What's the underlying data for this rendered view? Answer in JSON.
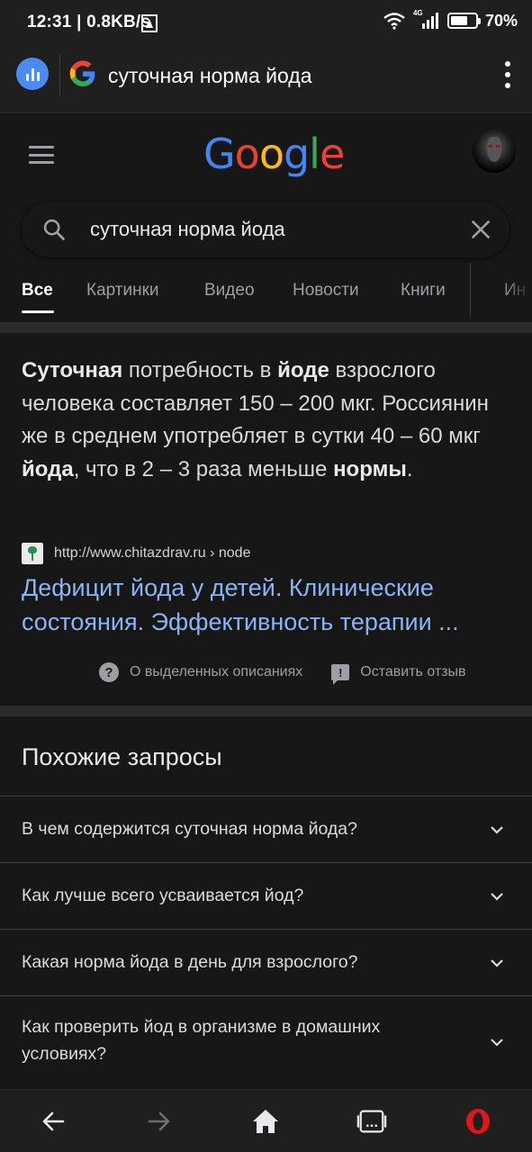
{
  "status_bar": {
    "time_speed": "12:31 | 0.8KB/s",
    "network": "4G",
    "battery_text": "70%",
    "battery_level": 0.7
  },
  "browser": {
    "url_title": "суточная норма йода"
  },
  "google": {
    "logo_letters": [
      "G",
      "o",
      "o",
      "g",
      "l",
      "e"
    ],
    "logo_colors": [
      "#4285f4",
      "#ea4335",
      "#fbbc05",
      "#4285f4",
      "#34a853",
      "#ea4335"
    ]
  },
  "search": {
    "query": "суточная норма йода"
  },
  "tabs": [
    {
      "label": "Все",
      "active": true
    },
    {
      "label": "Картинки",
      "active": false
    },
    {
      "label": "Видео",
      "active": false
    },
    {
      "label": "Новости",
      "active": false
    },
    {
      "label": "Книги",
      "active": false
    },
    {
      "label": "Ин",
      "active": false
    }
  ],
  "snippet": {
    "text_parts": [
      {
        "t": "Суточная",
        "b": true
      },
      {
        "t": " потребность в ",
        "b": false
      },
      {
        "t": "йоде",
        "b": true
      },
      {
        "t": " взрослого человека составляет 150 – 200 мкг. Россиянин же в среднем употребляет в сутки 40 – 60 мкг ",
        "b": false
      },
      {
        "t": "йода",
        "b": true
      },
      {
        "t": ", что в 2 – 3 раза меньше ",
        "b": false
      },
      {
        "t": "нормы",
        "b": true
      },
      {
        "t": ".",
        "b": false
      }
    ],
    "source_url": "http://www.chitazdrav.ru › node",
    "result_title": "Дефицит йода у детей. Клинические состояния. Эффективность терапии ...",
    "about_snippets": "О выделенных описаниях",
    "feedback": "Оставить отзыв"
  },
  "related": {
    "title": "Похожие запросы",
    "items": [
      "В чем содержится суточная норма йода?",
      "Как лучше всего усваивается йод?",
      "Какая норма йода в день для взрослого?",
      "Как проверить йод в организме в домашних условиях?"
    ]
  },
  "colors": {
    "link": "#8ab4f8",
    "opera_red": "#e0161b",
    "assistant_blue": "#4c8bf5"
  }
}
